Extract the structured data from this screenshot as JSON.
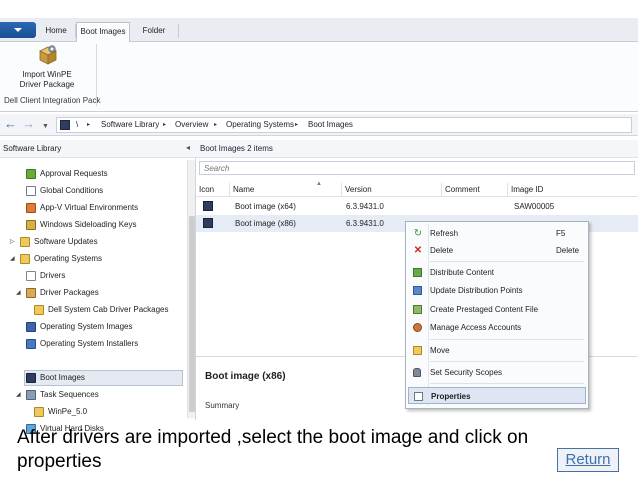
{
  "ribbon": {
    "tabs": [
      "Home",
      "Boot Images",
      "Folder"
    ],
    "import_button_label": "Import WinPE\nDriver Package",
    "group_label": "Dell Client Integration Pack"
  },
  "address": {
    "back": "←",
    "forward": "→",
    "dropdown": "▼",
    "root": "\\",
    "separator": "▸",
    "crumbs": [
      "Software Library",
      "Overview",
      "Operating Systems",
      "Boot Images"
    ]
  },
  "nav": {
    "title": "Software Library",
    "collapse": "◂",
    "expand_open": "◢",
    "expand_closed": "▷",
    "items": [
      {
        "label": "Approval Requests",
        "icon": "approval-icon"
      },
      {
        "label": "Global Conditions",
        "icon": "conditions-icon"
      },
      {
        "label": "App-V Virtual Environments",
        "icon": "appv-icon"
      },
      {
        "label": "Windows Sideloading Keys",
        "icon": "keys-icon"
      },
      {
        "label": "Software Updates",
        "icon": "folder-icon"
      },
      {
        "label": "Operating Systems",
        "icon": "folder-icon"
      },
      {
        "label": "Drivers",
        "icon": "drivers-icon"
      },
      {
        "label": "Driver Packages",
        "icon": "driver-packages-icon"
      },
      {
        "label": "Dell System Cab Driver Packages",
        "icon": "folder-icon"
      },
      {
        "label": "Operating System Images",
        "icon": "os-images-icon"
      },
      {
        "label": "Operating System Installers",
        "icon": "os-installers-icon"
      },
      {
        "label": "Boot Images",
        "icon": "boot-images-icon"
      },
      {
        "label": "Task Sequences",
        "icon": "task-sequences-icon"
      },
      {
        "label": "WinPe_5.0",
        "icon": "folder-icon"
      },
      {
        "label": "Virtual Hard Disks",
        "icon": "vhd-icon"
      }
    ]
  },
  "main": {
    "title": "Boot Images 2 items",
    "search_placeholder": "Search",
    "sort_indicator": "▲",
    "columns": [
      "Icon",
      "Name",
      "Version",
      "Comment",
      "Image ID"
    ],
    "rows": [
      {
        "name": "Boot image (x64)",
        "version": "6.3.9431.0",
        "comment": "",
        "image_id": "SAW00005"
      },
      {
        "name": "Boot image (x86)",
        "version": "6.3.9431.0",
        "comment": "",
        "image_id": ""
      }
    ],
    "details_title": "Boot image (x86)",
    "details_summary": "Summary"
  },
  "context_menu": {
    "items": [
      {
        "label": "Refresh",
        "shortcut": "F5",
        "icon": "refresh-icon"
      },
      {
        "label": "Delete",
        "shortcut": "Delete",
        "icon": "delete-icon"
      },
      {
        "label": "Distribute Content",
        "shortcut": "",
        "icon": "distribute-icon"
      },
      {
        "label": "Update Distribution Points",
        "shortcut": "",
        "icon": "update-dp-icon"
      },
      {
        "label": "Create Prestaged Content File",
        "shortcut": "",
        "icon": "prestage-icon"
      },
      {
        "label": "Manage Access Accounts",
        "shortcut": "",
        "icon": "accounts-icon"
      },
      {
        "label": "Move",
        "shortcut": "",
        "icon": "move-icon"
      },
      {
        "label": "Set Security Scopes",
        "shortcut": "",
        "icon": "security-icon"
      },
      {
        "label": "Properties",
        "shortcut": "",
        "icon": "properties-icon"
      }
    ]
  },
  "caption": {
    "text": "After drivers are imported ,select the boot image and click on properties",
    "return_label": "Return"
  },
  "colors": {
    "accent": "#2b67b3",
    "selection": "#e6ecf5",
    "return_link": "#3d6fb0"
  }
}
